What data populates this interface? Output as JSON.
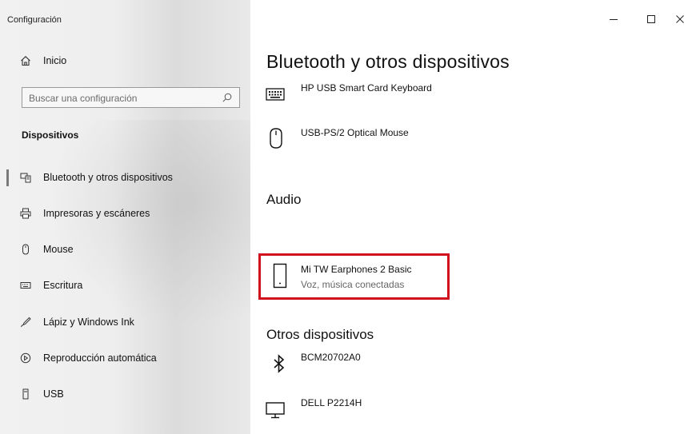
{
  "window": {
    "title": "Configuración",
    "controls": [
      "minimize-icon",
      "maximize-icon",
      "close-icon"
    ],
    "accent_color": "#d0101d"
  },
  "sidebar": {
    "home_label": "Inicio",
    "search_placeholder": "Buscar una configuración",
    "section_title": "Dispositivos",
    "items": [
      {
        "label": "Bluetooth y otros dispositivos",
        "icon": "devices-icon",
        "active": true
      },
      {
        "label": "Impresoras y escáneres",
        "icon": "printer-icon"
      },
      {
        "label": "Mouse",
        "icon": "mouse-icon"
      },
      {
        "label": "Escritura",
        "icon": "keyboard-icon"
      },
      {
        "label": "Lápiz y Windows Ink",
        "icon": "pen-icon"
      },
      {
        "label": "Reproducción automática",
        "icon": "autoplay-icon"
      },
      {
        "label": "USB",
        "icon": "usb-icon"
      }
    ]
  },
  "main": {
    "title": "Bluetooth y otros dispositivos",
    "devices": [
      {
        "name": "HP USB Smart Card Keyboard",
        "icon": "keyboard-icon"
      },
      {
        "name": "USB-PS/2 Optical Mouse",
        "icon": "mouse-icon"
      }
    ],
    "audio": {
      "heading": "Audio",
      "devices": [
        {
          "name": "Mi TW Earphones 2 Basic",
          "status": "Voz, música conectadas",
          "icon": "phone-device-icon"
        }
      ]
    },
    "other": {
      "heading": "Otros dispositivos",
      "devices": [
        {
          "name": "BCM20702A0",
          "icon": "bluetooth-icon"
        },
        {
          "name": "DELL P2214H",
          "icon": "monitor-icon"
        }
      ]
    }
  }
}
